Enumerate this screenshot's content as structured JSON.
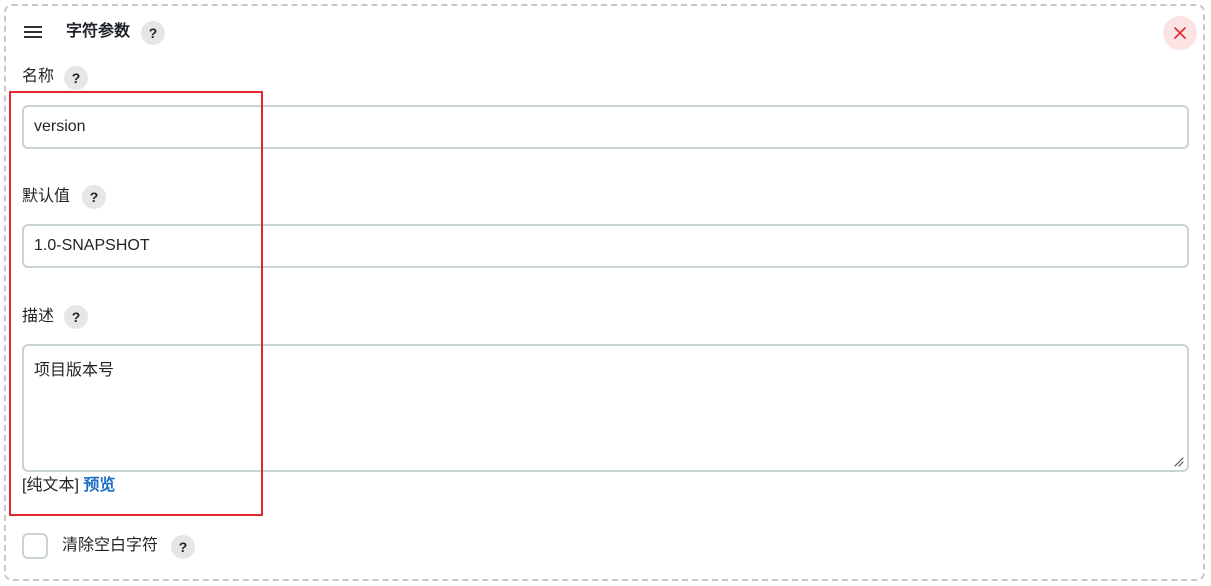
{
  "header": {
    "title": "字符参数",
    "help_label": "?"
  },
  "fields": {
    "name": {
      "label": "名称",
      "help_label": "?",
      "value": "version"
    },
    "default_value": {
      "label": "默认值",
      "help_label": "?",
      "value": "1.0-SNAPSHOT"
    },
    "description": {
      "label": "描述",
      "help_label": "?",
      "value": "项目版本号",
      "format_prefix": "[纯文本]",
      "preview_label": "预览"
    }
  },
  "trim": {
    "label": "清除空白字符",
    "help_label": "?",
    "checked": false
  },
  "colors": {
    "close_bg": "#fbe3e4",
    "close_icon": "#e0282e",
    "highlight": "#e0282e",
    "link": "#1f6fc6",
    "input_border": "#c9d3d3"
  },
  "icons": {
    "drag": "hamburger-icon",
    "close": "close-icon",
    "help": "question-mark-icon",
    "resize": "resize-grip-icon"
  }
}
